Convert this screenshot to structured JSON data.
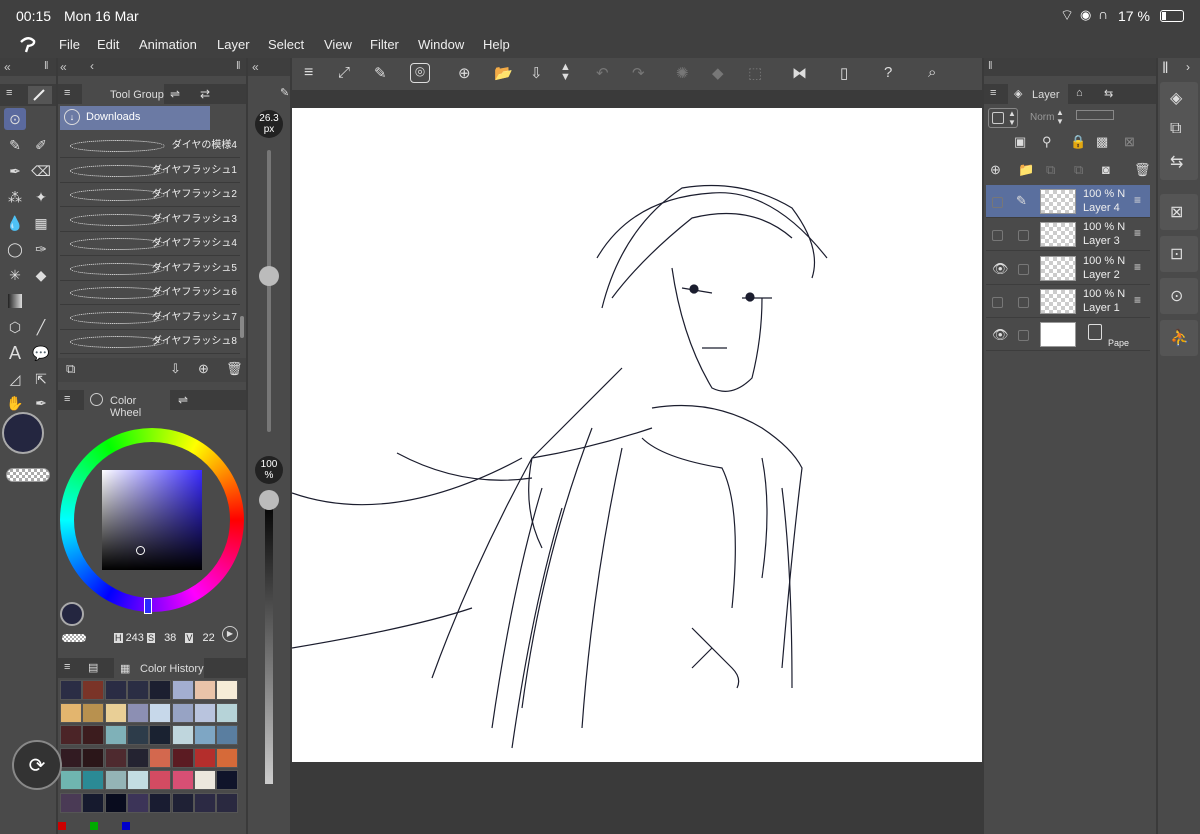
{
  "status": {
    "time": "00:15",
    "date": "Mon 16 Mar",
    "battery": "17 %"
  },
  "menu": [
    "File",
    "Edit",
    "Animation",
    "Layer",
    "Select",
    "View",
    "Filter",
    "Window",
    "Help"
  ],
  "tool_group": {
    "tab_label": "Tool Group",
    "folder_label": "Downloads"
  },
  "brushes": [
    "ダイヤの模様4",
    "ダイヤフラッシュ1",
    "ダイヤフラッシュ2",
    "ダイヤフラッシュ3",
    "ダイヤフラッシュ4",
    "ダイヤフラッシュ5",
    "ダイヤフラッシュ6",
    "ダイヤフラッシュ7",
    "ダイヤフラッシュ8"
  ],
  "brush_size": {
    "value": "26.3",
    "unit": "px"
  },
  "opacity": {
    "value": "100",
    "unit": "%"
  },
  "color_wheel": {
    "tab_label": "Color Wheel",
    "h_label": "H",
    "h": "243",
    "s_label": "S",
    "s": "38",
    "v_label": "V",
    "v": "22"
  },
  "color_history": {
    "tab_label": "Color History",
    "swatches": [
      "#2b2d45",
      "#7a3428",
      "#2a2c44",
      "#2b2e44",
      "#1c1f30",
      "#a3aed0",
      "#e9c3a9",
      "#f6ecd8",
      "#e3b56e",
      "#b8914f",
      "#e9cf96",
      "#8c8fb3",
      "#c7d8ea",
      "#97a3c4",
      "#b9c4de",
      "#b6d3d8",
      "#4b2427",
      "#3c1c1e",
      "#7fb1b8",
      "#2d3c4a",
      "#1a2231",
      "#bfd6dd",
      "#7ea6c4",
      "#5a7ea0",
      "#321b22",
      "#2b1619",
      "#4e2a2f",
      "#242331",
      "#d3684e",
      "#5b1b22",
      "#b42e2c",
      "#d66a39",
      "#6fb5b0",
      "#2b8a95",
      "#94b4b6",
      "#c3dde2",
      "#d34b62",
      "#d84f74",
      "#ece7dd",
      "#10142a",
      "#4a3a55",
      "#161a2e",
      "#090c1e",
      "#3c3458",
      "#191c31",
      "#1f2135",
      "#2c2a44",
      "#2a2940"
    ]
  },
  "layer_panel": {
    "tab_label": "Layer",
    "blend_mode": "Norm"
  },
  "layers": [
    {
      "opacity": "100 %",
      "mode": "N",
      "name": "Layer 4",
      "visible": false,
      "selected": true
    },
    {
      "opacity": "100 %",
      "mode": "N",
      "name": "Layer 3",
      "visible": false,
      "selected": false
    },
    {
      "opacity": "100 %",
      "mode": "N",
      "name": "Layer 2",
      "visible": true,
      "selected": false
    },
    {
      "opacity": "100 %",
      "mode": "N",
      "name": "Layer 1",
      "visible": false,
      "selected": false
    }
  ],
  "paper_layer": {
    "name": "Pape",
    "visible": true
  },
  "colors": {
    "main": "#242640",
    "sub": "#7a3428",
    "accent": "#5b6a9e",
    "selected_layer": "#5a6f9e"
  }
}
